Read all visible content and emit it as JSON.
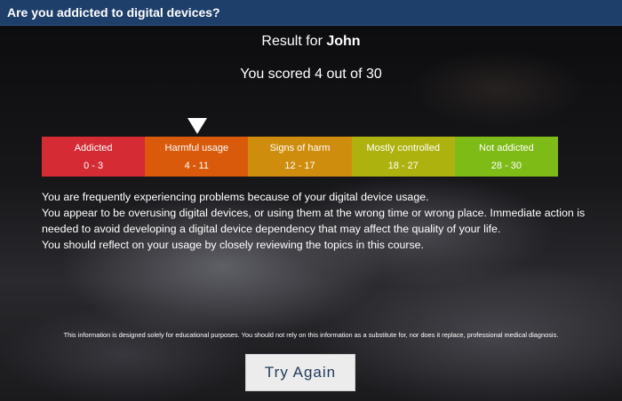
{
  "window": {
    "title": "Are you addicted to digital devices?"
  },
  "result": {
    "prefix": "Result for ",
    "name": "John",
    "score_text": "You scored 4 out of 30"
  },
  "scale": [
    {
      "label": "Addicted",
      "range": "0 - 3",
      "color": "#d42b35"
    },
    {
      "label": "Harmful usage",
      "range": "4 - 11",
      "color": "#da5a0c"
    },
    {
      "label": "Signs of harm",
      "range": "12 - 17",
      "color": "#cf8d0d"
    },
    {
      "label": "Mostly controlled",
      "range": "18 - 27",
      "color": "#aeb20f"
    },
    {
      "label": "Not addicted",
      "range": "28 - 30",
      "color": "#7fbb16"
    }
  ],
  "marker": {
    "selected_index": 1
  },
  "description": [
    "You are frequently experiencing problems because of your digital device usage.",
    "You appear to be overusing digital devices, or using them at the wrong time or wrong place. Immediate action is needed to avoid developing a digital device dependency that may affect the quality of your life.",
    "You should reflect on your usage by closely reviewing the topics in this course."
  ],
  "disclaimer": "This information is designed solely for educational purposes. You should not rely on this information as a substitute for, nor does it replace, professional medical diagnosis.",
  "button": {
    "label": "Try Again"
  }
}
